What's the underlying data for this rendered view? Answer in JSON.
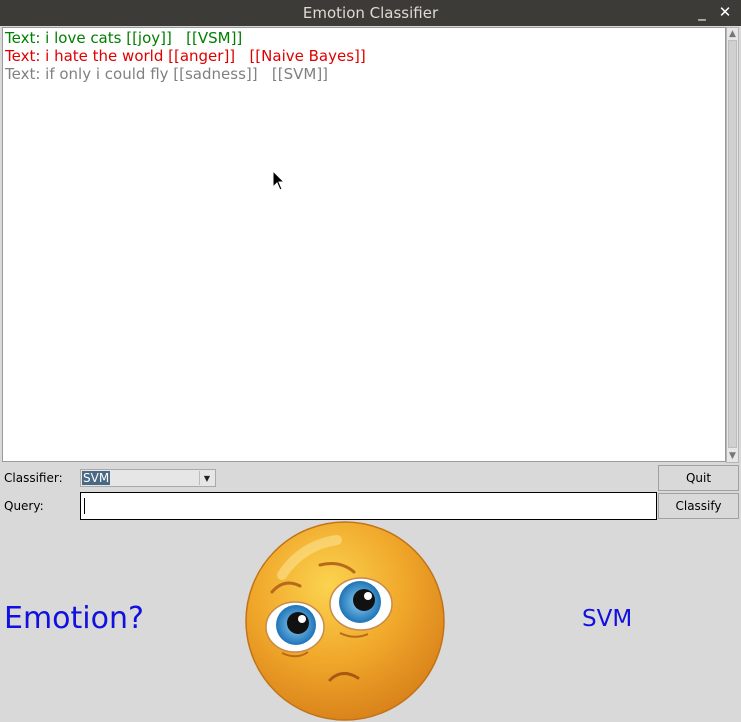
{
  "window": {
    "title": "Emotion Classifier",
    "minimize_symbol": "_",
    "close_symbol": "✕"
  },
  "log": {
    "lines": [
      {
        "text": "Text: i love cats [[joy]]   [[VSM]]",
        "color": "#008000"
      },
      {
        "text": "Text: i hate the world [[anger]]   [[Naive Bayes]]",
        "color": "#e00000"
      },
      {
        "text": "Text: if only i could fly [[sadness]]   [[SVM]]",
        "color": "#808080"
      }
    ]
  },
  "controls": {
    "classifier_label": "Classifier:",
    "classifier_value": "SVM",
    "query_label": "Query:",
    "query_value": "",
    "quit_label": "Quit",
    "classify_label": "Classify"
  },
  "result": {
    "emotion_label": "Emotion?",
    "model_label": "SVM",
    "emoji_icon": "sad-face-emoji-icon"
  },
  "colors": {
    "accent_blue": "#1010e0",
    "titlebar": "#3c3b37",
    "emoji_orange": "#e8951f"
  }
}
